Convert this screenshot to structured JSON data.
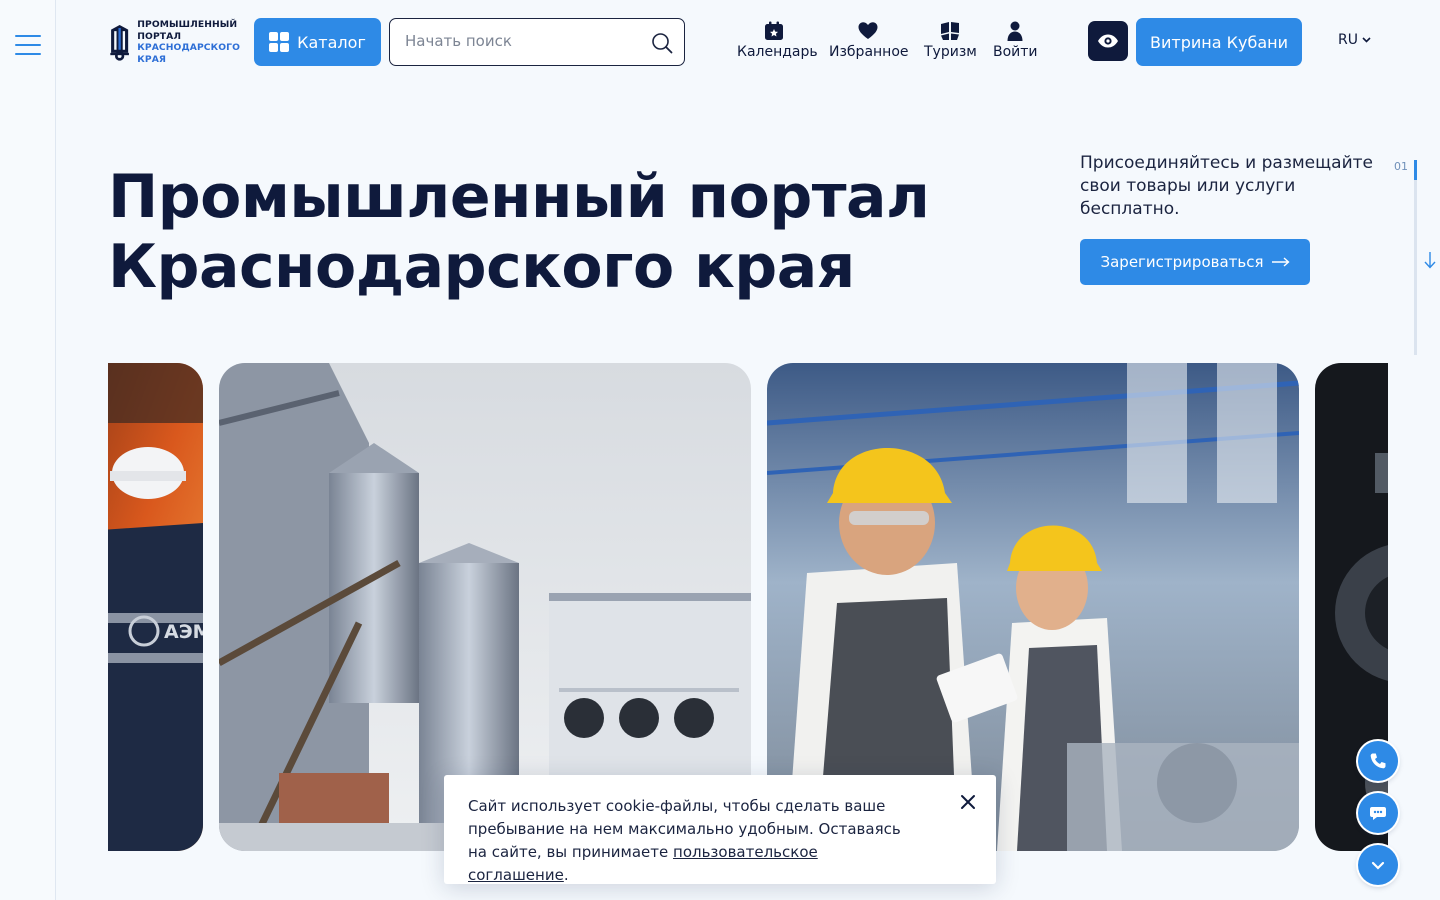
{
  "brand": {
    "logo_lines": [
      "ПРОМЫШЛЕННЫЙ",
      "ПОРТАЛ",
      "КРАСНОДАРСКОГО",
      "КРАЯ"
    ]
  },
  "header": {
    "catalog_label": "Каталог",
    "search_placeholder": "Начать поиск",
    "nav": [
      {
        "label": "Календарь",
        "icon": "calendar-icon"
      },
      {
        "label": "Избранное",
        "icon": "heart-icon"
      },
      {
        "label": "Туризм",
        "icon": "tourism-icon"
      },
      {
        "label": "Войти",
        "icon": "user-icon"
      }
    ],
    "accessibility_icon": "eye-icon",
    "vitrina_label": "Витрина Кубани",
    "lang": "RU"
  },
  "hero": {
    "title_line1": "Промышленный портал",
    "title_line2": "Краснодарского края",
    "lead": "Присоединяйтесь и размещайте свои товары или услуги бесплатно.",
    "register_label": "Зарегистрироваться",
    "slide_index": "01"
  },
  "gallery": {
    "worker_jacket_text": "АЭМ"
  },
  "floating": [
    "phone-icon",
    "chat-icon",
    "chevron-down-icon"
  ],
  "cookie": {
    "text": "Сайт использует cookie-файлы, чтобы сделать ваше пребывание на нем максимально удобным. Оставаясь на сайте, вы принимаете ",
    "link": "пользовательское соглашение",
    "end": "."
  },
  "colors": {
    "accent": "#2e8ae6",
    "dark": "#0f1a3c",
    "background": "#f5f9fd"
  }
}
